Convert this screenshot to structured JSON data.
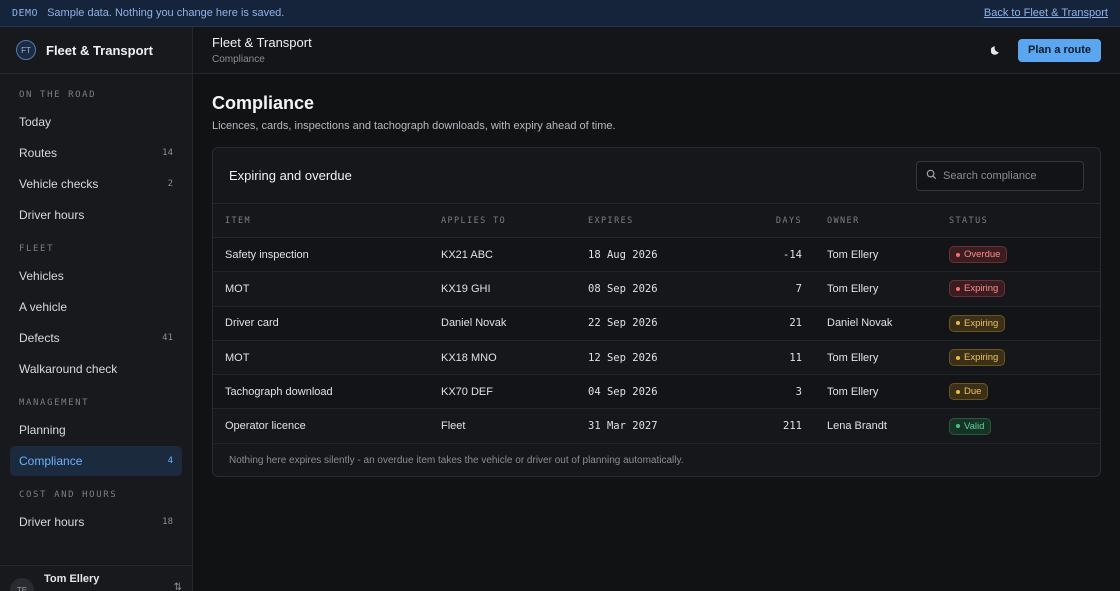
{
  "banner": {
    "tag": "DEMO",
    "message": "Sample data. Nothing you change here is saved.",
    "back_link": "Back to Fleet & Transport"
  },
  "brand": {
    "initials": "FT",
    "name": "Fleet & Transport"
  },
  "sidebar": {
    "sections": [
      {
        "label": "ON THE ROAD",
        "items": [
          {
            "label": "Today",
            "count": ""
          },
          {
            "label": "Routes",
            "count": "14"
          },
          {
            "label": "Vehicle checks",
            "count": "2"
          },
          {
            "label": "Driver hours",
            "count": ""
          }
        ]
      },
      {
        "label": "FLEET",
        "items": [
          {
            "label": "Vehicles",
            "count": ""
          },
          {
            "label": "A vehicle",
            "count": ""
          },
          {
            "label": "Defects",
            "count": "41"
          },
          {
            "label": "Walkaround check",
            "count": ""
          }
        ]
      },
      {
        "label": "MANAGEMENT",
        "items": [
          {
            "label": "Planning",
            "count": ""
          },
          {
            "label": "Compliance",
            "count": "4",
            "active": true
          }
        ]
      },
      {
        "label": "COST AND HOURS",
        "items": [
          {
            "label": "Driver hours",
            "count": "18"
          }
        ]
      }
    ]
  },
  "user": {
    "initials": "TE",
    "name": "Tom Ellery"
  },
  "topbar": {
    "title": "Fleet & Transport",
    "subtitle": "Compliance",
    "theme_icon": "moon-icon",
    "cta": "Plan a route"
  },
  "page": {
    "title": "Compliance",
    "description": "Licences, cards, inspections and tachograph downloads, with expiry ahead of time."
  },
  "table": {
    "title": "Expiring and overdue",
    "search_placeholder": "Search compliance",
    "columns": [
      "ITEM",
      "APPLIES TO",
      "EXPIRES",
      "DAYS",
      "OWNER",
      "STATUS"
    ],
    "rows": [
      {
        "item": "Safety inspection",
        "applies_to": "KX21 ABC",
        "expires": "18 Aug 2026",
        "days": "-14",
        "owner": "Tom Ellery",
        "status": "Overdue",
        "status_kind": "overdue"
      },
      {
        "item": "MOT",
        "applies_to": "KX19 GHI",
        "expires": "08 Sep 2026",
        "days": "7",
        "owner": "Tom Ellery",
        "status": "Expiring",
        "status_kind": "expiring-red"
      },
      {
        "item": "Driver card",
        "applies_to": "Daniel Novak",
        "expires": "22 Sep 2026",
        "days": "21",
        "owner": "Daniel Novak",
        "status": "Expiring",
        "status_kind": "expiring"
      },
      {
        "item": "MOT",
        "applies_to": "KX18 MNO",
        "expires": "12 Sep 2026",
        "days": "11",
        "owner": "Tom Ellery",
        "status": "Expiring",
        "status_kind": "expiring"
      },
      {
        "item": "Tachograph download",
        "applies_to": "KX70 DEF",
        "expires": "04 Sep 2026",
        "days": "3",
        "owner": "Tom Ellery",
        "status": "Due",
        "status_kind": "due"
      },
      {
        "item": "Operator licence",
        "applies_to": "Fleet",
        "expires": "31 Mar 2027",
        "days": "211",
        "owner": "Lena Brandt",
        "status": "Valid",
        "status_kind": "valid"
      }
    ],
    "footnote": "Nothing here expires silently - an overdue item takes the vehicle or driver out of planning automatically."
  }
}
